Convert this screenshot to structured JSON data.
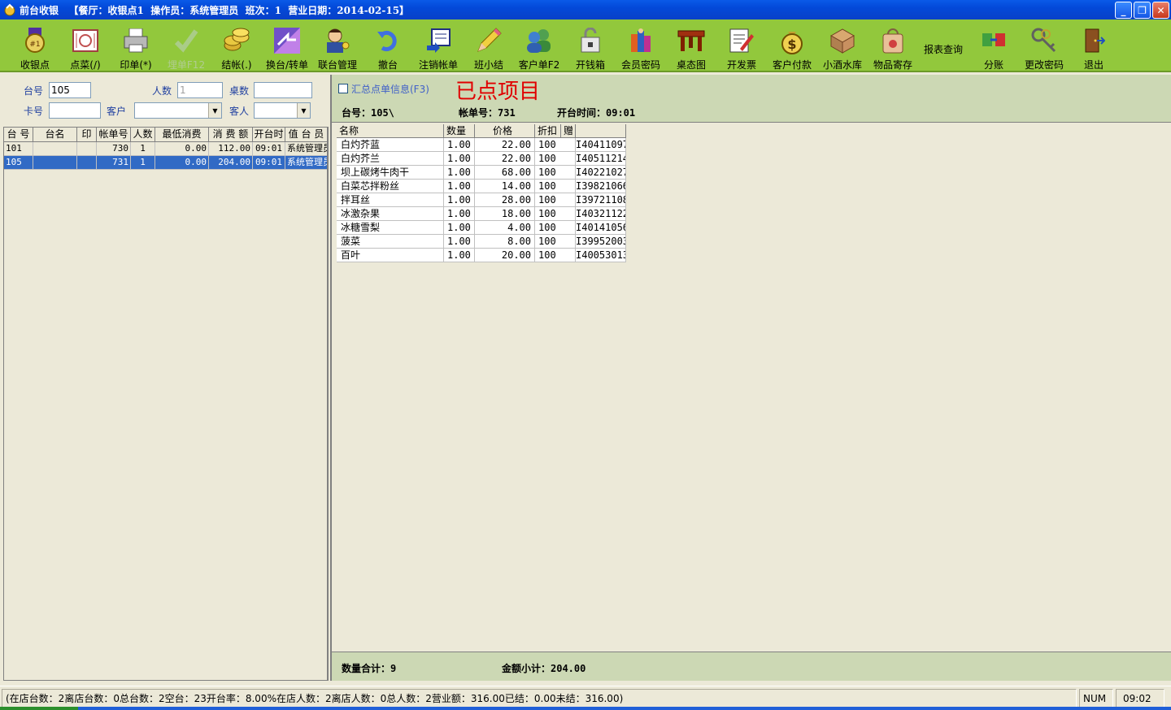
{
  "window": {
    "title": "前台收银   【餐厅：收银点1  操作员：系统管理员  班次：1  营业日期：2014-02-15】",
    "controls": {
      "minimize": "_",
      "restore": "❐",
      "close": "✕"
    }
  },
  "toolbar": {
    "items": [
      {
        "label": "收银点",
        "icon": "badge-icon",
        "enabled": true
      },
      {
        "label": "点菜(/)",
        "icon": "menu-icon",
        "enabled": true
      },
      {
        "label": "印单(*)",
        "icon": "printer-icon",
        "enabled": true
      },
      {
        "label": "埋单F12",
        "icon": "check-icon",
        "enabled": false
      },
      {
        "label": "结帐(.)",
        "icon": "coins-icon",
        "enabled": true
      },
      {
        "label": "换台/转单",
        "icon": "swap-icon",
        "enabled": true
      },
      {
        "label": "联台管理",
        "icon": "user-key-icon",
        "enabled": true
      },
      {
        "label": "撤台",
        "icon": "undo-icon",
        "enabled": true
      },
      {
        "label": "注销帐单",
        "icon": "cancel-bill-icon",
        "enabled": true
      },
      {
        "label": "班小结",
        "icon": "pencil-icon",
        "enabled": true
      },
      {
        "label": "客户单F2",
        "icon": "users-icon",
        "enabled": true
      },
      {
        "label": "开钱箱",
        "icon": "cashbox-icon",
        "enabled": true
      },
      {
        "label": "会员密码",
        "icon": "member-icon",
        "enabled": true
      },
      {
        "label": "桌态图",
        "icon": "table-icon",
        "enabled": true
      },
      {
        "label": "开发票",
        "icon": "invoice-icon",
        "enabled": true
      },
      {
        "label": "客户付款",
        "icon": "money-bag-icon",
        "enabled": true
      },
      {
        "label": "小酒水库",
        "icon": "box-icon",
        "enabled": true
      },
      {
        "label": "物品寄存",
        "icon": "bag-icon",
        "enabled": true
      },
      {
        "label": "报表查询",
        "icon": "",
        "enabled": true
      },
      {
        "label": "分账",
        "icon": "split-icon",
        "enabled": true
      },
      {
        "label": "更改密码",
        "icon": "keys-icon",
        "enabled": true
      },
      {
        "label": "退出",
        "icon": "exit-door-icon",
        "enabled": true
      }
    ]
  },
  "filter": {
    "table_no_label": "台号",
    "table_no_value": "105",
    "people_label": "人数",
    "people_value": "1",
    "desk_count_label": "桌数",
    "desk_count_value": "",
    "card_label": "卡号",
    "card_value": "",
    "customer_label": "客户",
    "customer_value": "",
    "guest_label": "客人",
    "guest_value": ""
  },
  "tables_grid": {
    "columns": [
      "台 号",
      "台名",
      "印",
      "帐单号",
      "人数",
      "最低消费",
      "消 费 额",
      "开台时",
      "值 台 员"
    ],
    "rows": [
      {
        "table_no": "101",
        "name": "",
        "printed": "",
        "bill_no": "730",
        "people": "1",
        "min_spend": "0.00",
        "amount": "112.00",
        "open_time": "09:01",
        "staff": "系统管理员",
        "selected": false
      },
      {
        "table_no": "105",
        "name": "",
        "printed": "",
        "bill_no": "731",
        "people": "1",
        "min_spend": "0.00",
        "amount": "204.00",
        "open_time": "09:01",
        "staff": "系统管理员",
        "selected": true
      }
    ]
  },
  "order_panel": {
    "summary_checkbox_label": "汇总点单信息(F3)",
    "summary_checked": false,
    "heading": "已点项目",
    "table_no": "台号：105\\",
    "bill_no": "帐单号：731",
    "open_time": "开台时间：09:01",
    "columns": [
      "名称",
      "数量",
      "价格",
      "折扣",
      "赠"
    ],
    "items": [
      {
        "name": "白灼芥蓝",
        "qty": "1.00",
        "price": "22.00",
        "discount": "100",
        "code": "I40411097"
      },
      {
        "name": "白灼芥兰",
        "qty": "1.00",
        "price": "22.00",
        "discount": "100",
        "code": "I40511214"
      },
      {
        "name": "坝上碳烤牛肉干",
        "qty": "1.00",
        "price": "68.00",
        "discount": "100",
        "code": "I40221027"
      },
      {
        "name": "白菜芯拌粉丝",
        "qty": "1.00",
        "price": "14.00",
        "discount": "100",
        "code": "I39821066"
      },
      {
        "name": "拌耳丝",
        "qty": "1.00",
        "price": "28.00",
        "discount": "100",
        "code": "I39721108"
      },
      {
        "name": "冰激杂果",
        "qty": "1.00",
        "price": "18.00",
        "discount": "100",
        "code": "I40321122"
      },
      {
        "name": "冰糖雪梨",
        "qty": "1.00",
        "price": "4.00",
        "discount": "100",
        "code": "I40141056"
      },
      {
        "name": "菠菜",
        "qty": "1.00",
        "price": "8.00",
        "discount": "100",
        "code": "I39952003"
      },
      {
        "name": "百叶",
        "qty": "1.00",
        "price": "20.00",
        "discount": "100",
        "code": "I40053013"
      }
    ],
    "total_qty": "数量合计：9",
    "subtotal": "金额小计：204.00"
  },
  "statusbar": {
    "summary": "(在店台数：2离店台数：0总台数：2空台：23开台率：8.00%在店人数：2离店人数：0总人数：2营业额：316.00已结：0.00未结：316.00)",
    "num": "NUM",
    "time": "09:02"
  },
  "colors": {
    "toolbar_bg": "#92c83c",
    "panel_bg": "#ccd8b4",
    "selection": "#316ac5",
    "heading_red": "#e00000"
  }
}
